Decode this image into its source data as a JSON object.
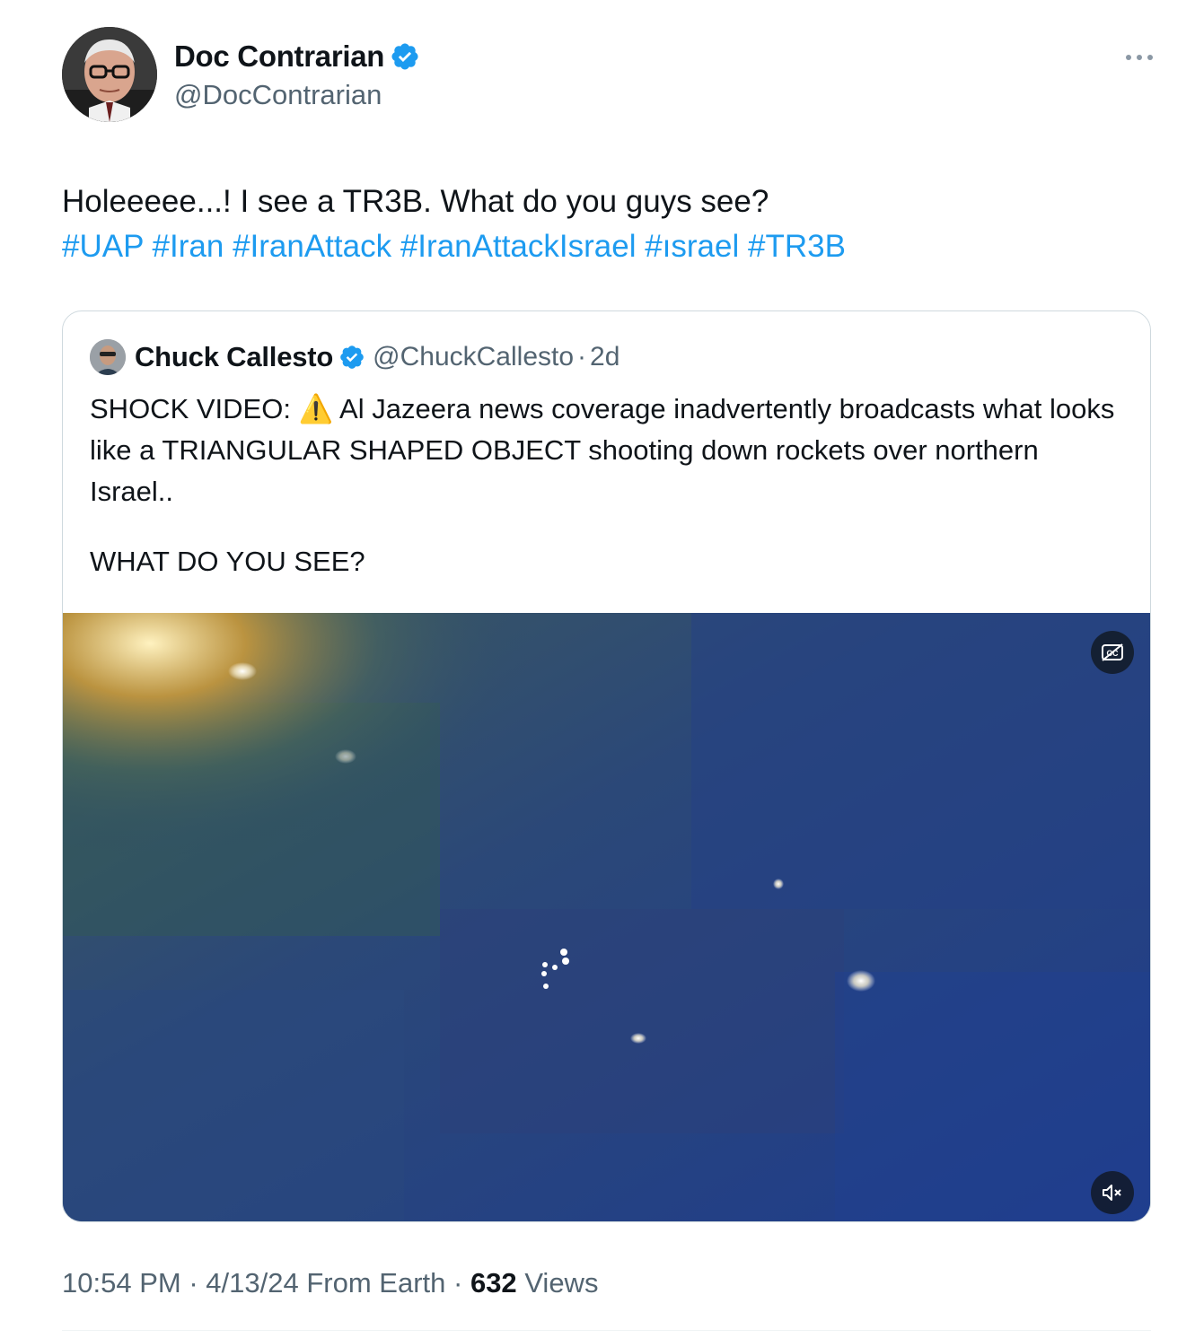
{
  "author": {
    "display_name": "Doc Contrarian",
    "handle": "@DocContrarian",
    "verified": true
  },
  "tweet": {
    "text": "Holeeeee...! I see a TR3B. What do you guys see?",
    "hashtags": [
      "#UAP",
      "#Iran",
      "#IranAttack",
      "#IranAttackIsrael",
      "#ısrael",
      "#TR3B"
    ]
  },
  "quoted_tweet": {
    "display_name": "Chuck Callesto",
    "handle": "@ChuckCallesto",
    "separator": "·",
    "time": "2d",
    "verified": true,
    "text_line1_prefix": "SHOCK VIDEO: ",
    "warning_emoji": "⚠️",
    "text_line1_rest": "  Al Jazeera news coverage inadvertently broadcasts what looks like a TRIANGULAR SHAPED OBJECT shooting down rockets over northern Israel..",
    "text_line2": "WHAT DO YOU SEE?",
    "media": {
      "type": "video",
      "captions_icon": "captions-icon",
      "mute_icon": "muted-speaker-icon"
    }
  },
  "meta": {
    "time": "10:54 PM",
    "sep1": "·",
    "date": "4/13/24",
    "source": "From Earth",
    "sep2": "·",
    "views_count": "632",
    "views_label": "Views"
  },
  "colors": {
    "accent": "#1d9bf0",
    "secondary_text": "#536471",
    "border": "#cfd9de"
  }
}
